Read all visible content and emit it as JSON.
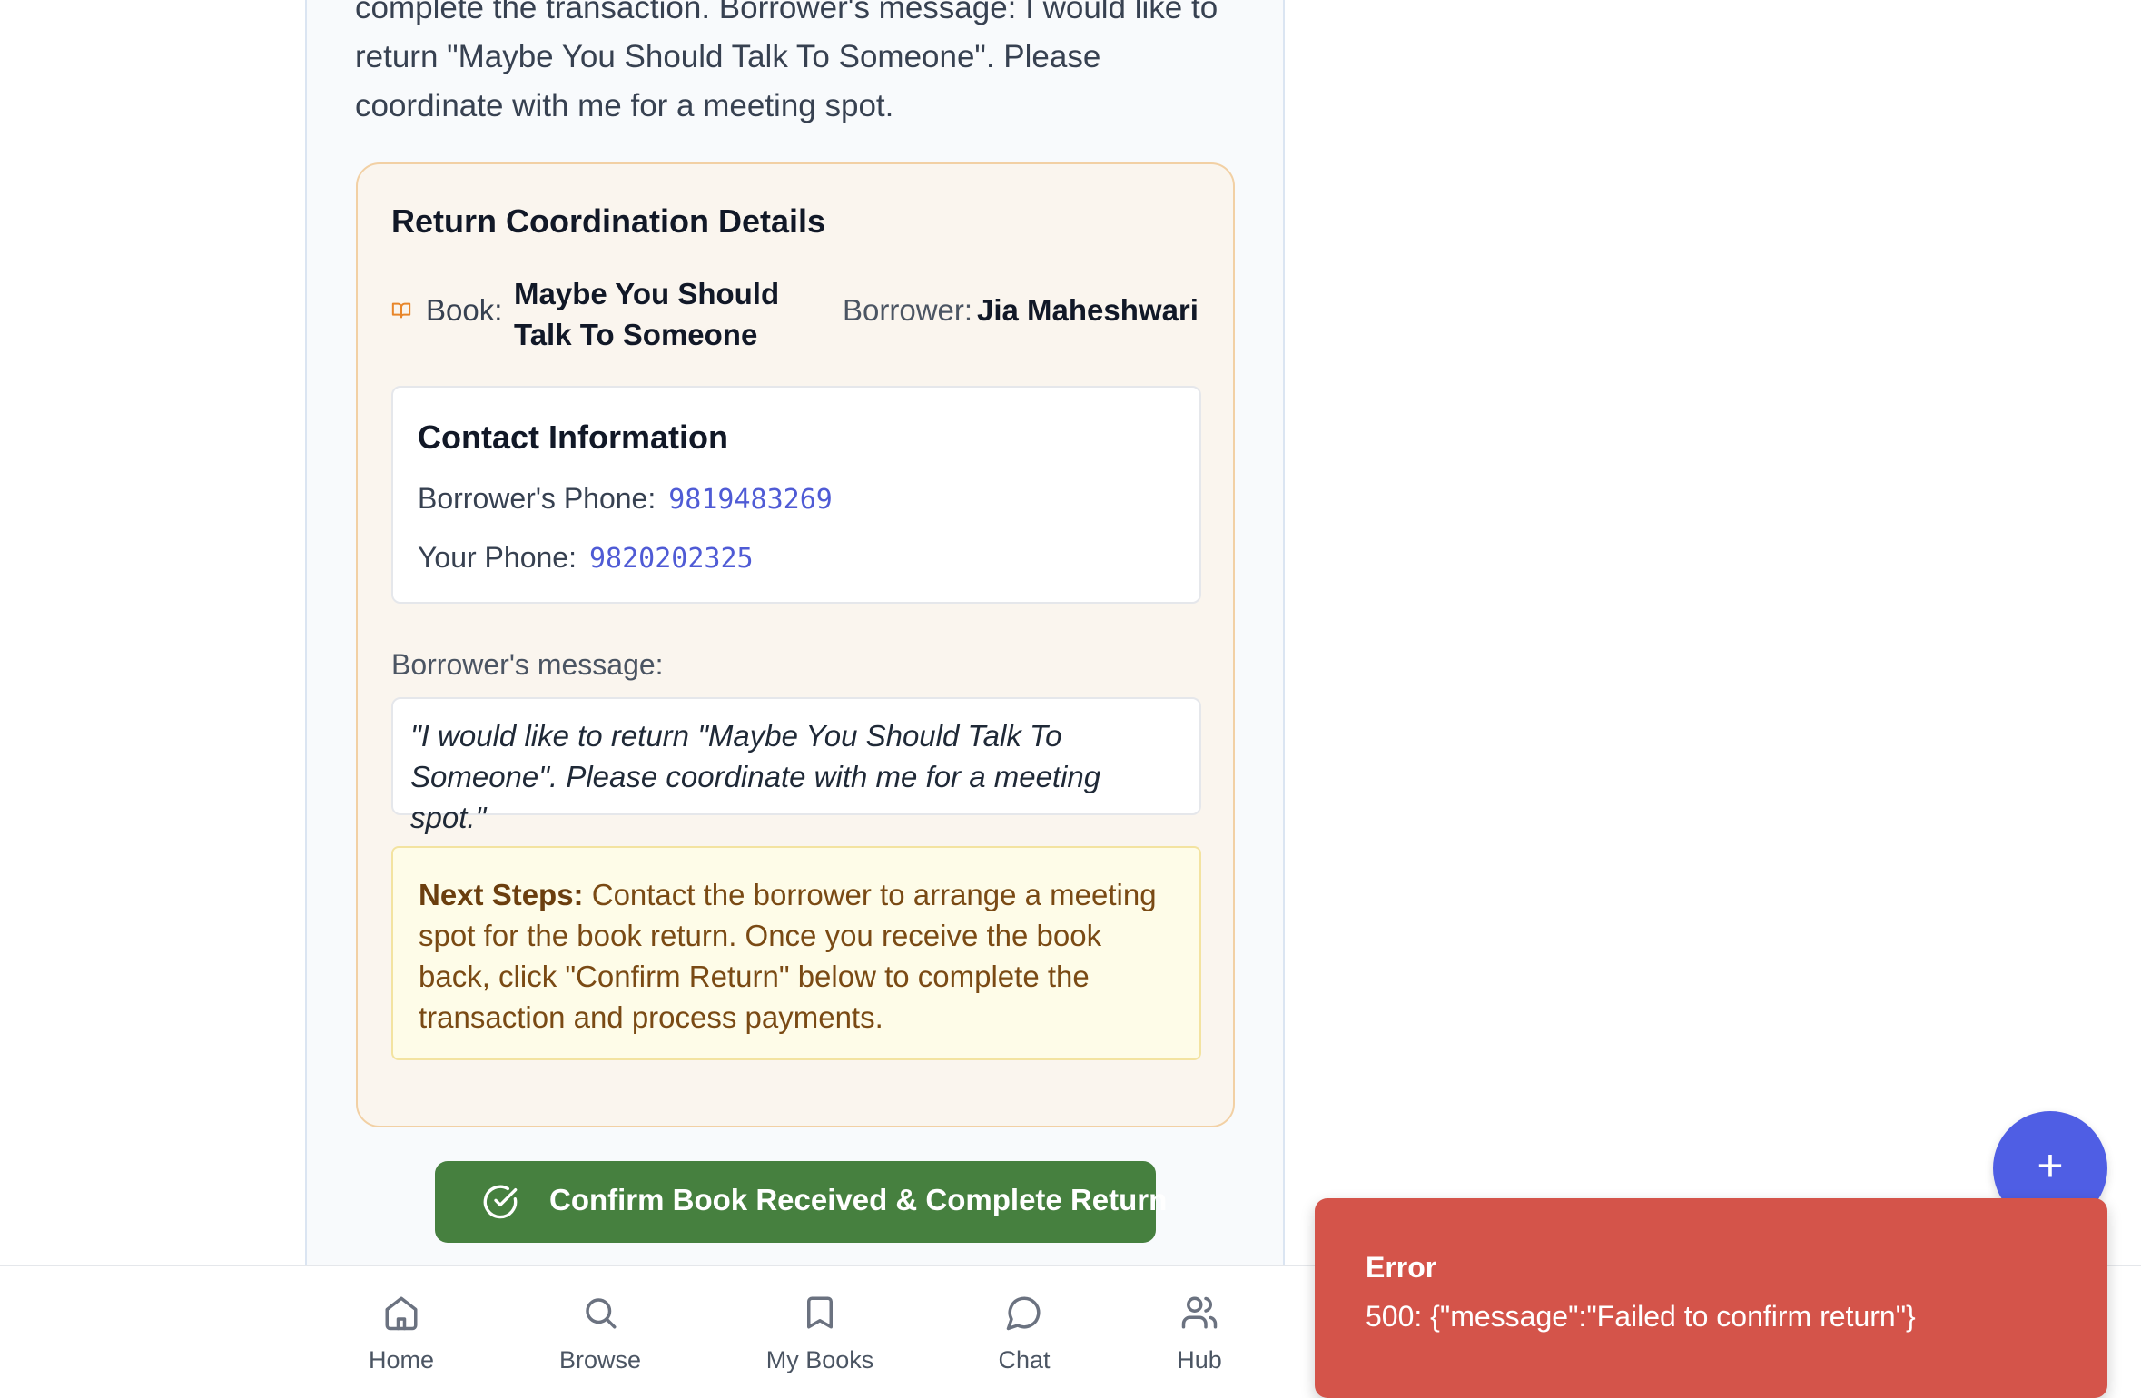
{
  "intro": {
    "text": "complete the transaction. Borrower's message: I would like to return \"Maybe You Should Talk To Someone\". Please coordinate with me for a meeting spot."
  },
  "return_card": {
    "title": "Return Coordination Details",
    "book_icon": "book-open-icon",
    "book_label": "Book:",
    "book_value": "Maybe You Should Talk To Someone",
    "borrower_label": "Borrower:",
    "borrower_value": "Jia Maheshwari",
    "contact": {
      "title": "Contact Information",
      "borrower_phone_label": "Borrower's Phone:",
      "borrower_phone": "9819483269",
      "your_phone_label": "Your Phone:",
      "your_phone": "9820202325"
    },
    "message_label": "Borrower's message:",
    "message": "\"I would like to return \"Maybe You Should Talk To Someone\". Please coordinate with me for a meeting spot.\"",
    "next_steps_label": "Next Steps:",
    "next_steps_text": " Contact the borrower to arrange a meeting spot for the book return. Once you receive the book back, click \"Confirm Return\" below to complete the transaction and process payments."
  },
  "confirm_button": {
    "label": "Confirm Book Received & Complete Return",
    "icon": "check-circle-icon",
    "color": "#46803f"
  },
  "bottom_nav": {
    "items": [
      {
        "label": "Home",
        "icon": "home-icon"
      },
      {
        "label": "Browse",
        "icon": "search-icon"
      },
      {
        "label": "My Books",
        "icon": "bookmark-icon"
      },
      {
        "label": "Chat",
        "icon": "chat-bubble-icon"
      },
      {
        "label": "Hub",
        "icon": "users-icon"
      }
    ]
  },
  "fab": {
    "label": "+",
    "icon": "plus-icon",
    "color": "#4f5ee4"
  },
  "toast": {
    "title": "Error",
    "message": "500: {\"message\":\"Failed to confirm return\"}",
    "color": "#d4544a"
  }
}
